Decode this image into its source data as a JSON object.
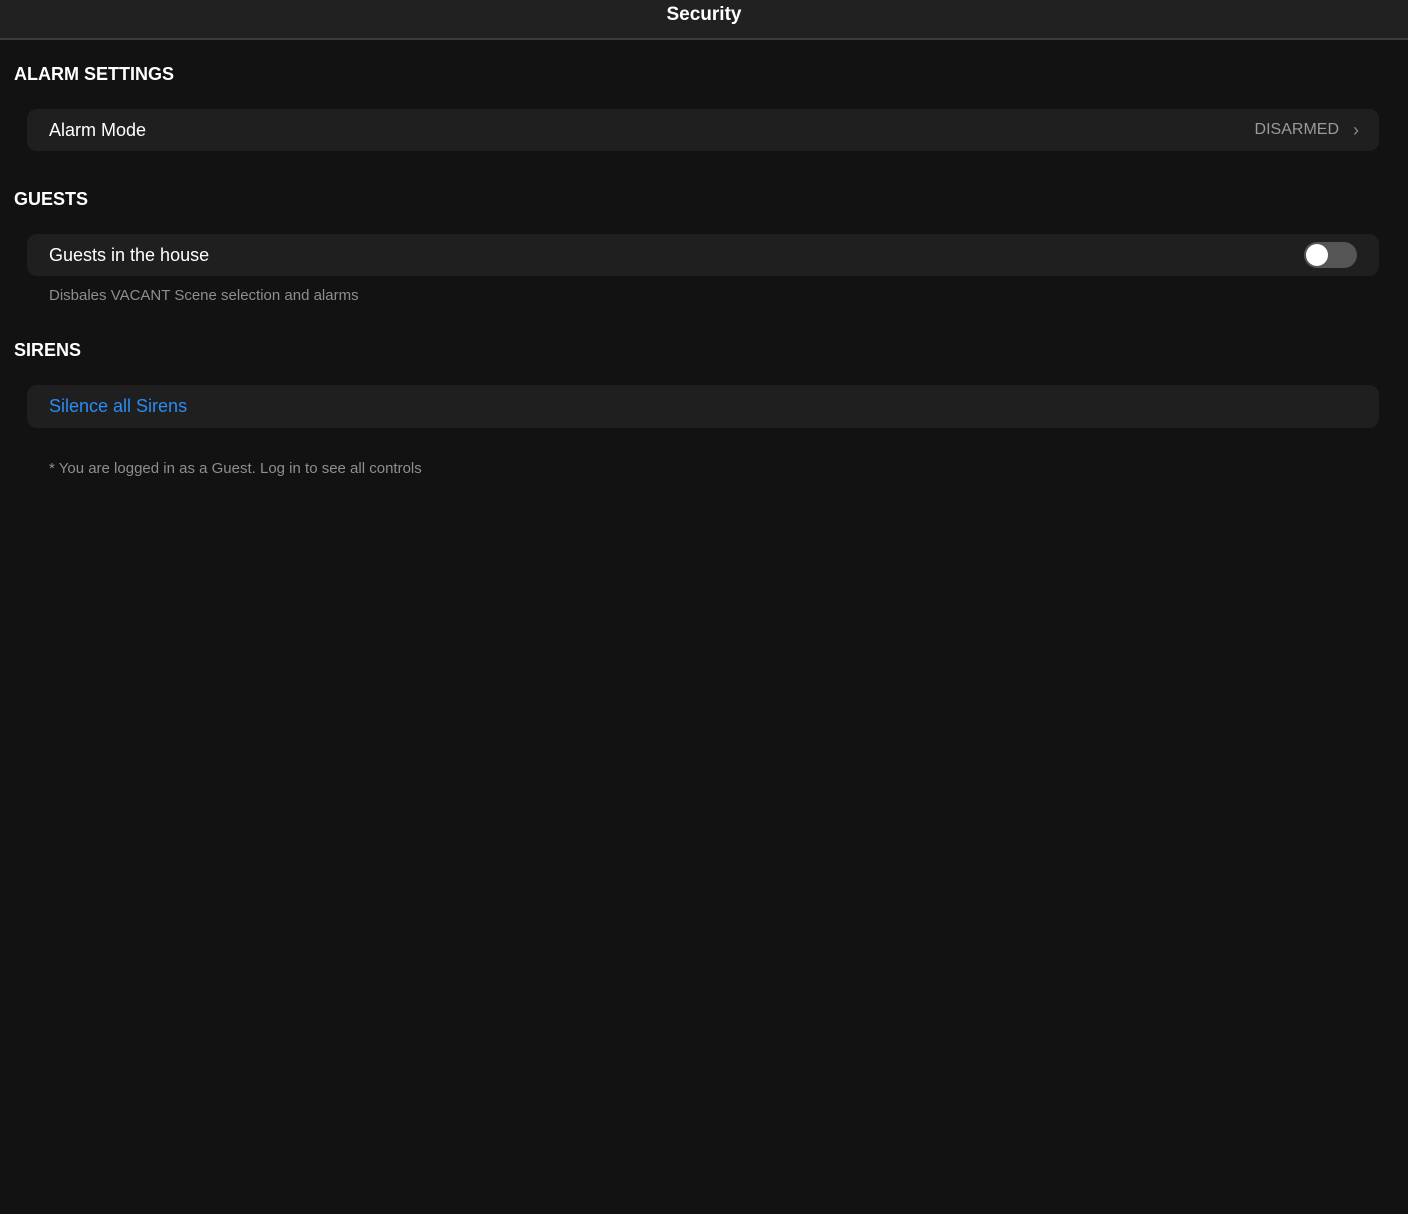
{
  "header": {
    "title": "Security"
  },
  "alarm": {
    "section": "ALARM SETTINGS",
    "mode_label": "Alarm Mode",
    "mode_value": "DISARMED"
  },
  "guests": {
    "section": "GUESTS",
    "label": "Guests in the house",
    "toggle_on": false,
    "note": "Disbales VACANT Scene selection and alarms"
  },
  "sirens": {
    "section": "SIRENS",
    "silence_label": "Silence all Sirens"
  },
  "footer": {
    "note": "* You are logged in as a Guest. Log in to see all controls"
  },
  "colors": {
    "accent": "#2a8cf5",
    "background": "#121212",
    "card": "#1f1f1f"
  }
}
